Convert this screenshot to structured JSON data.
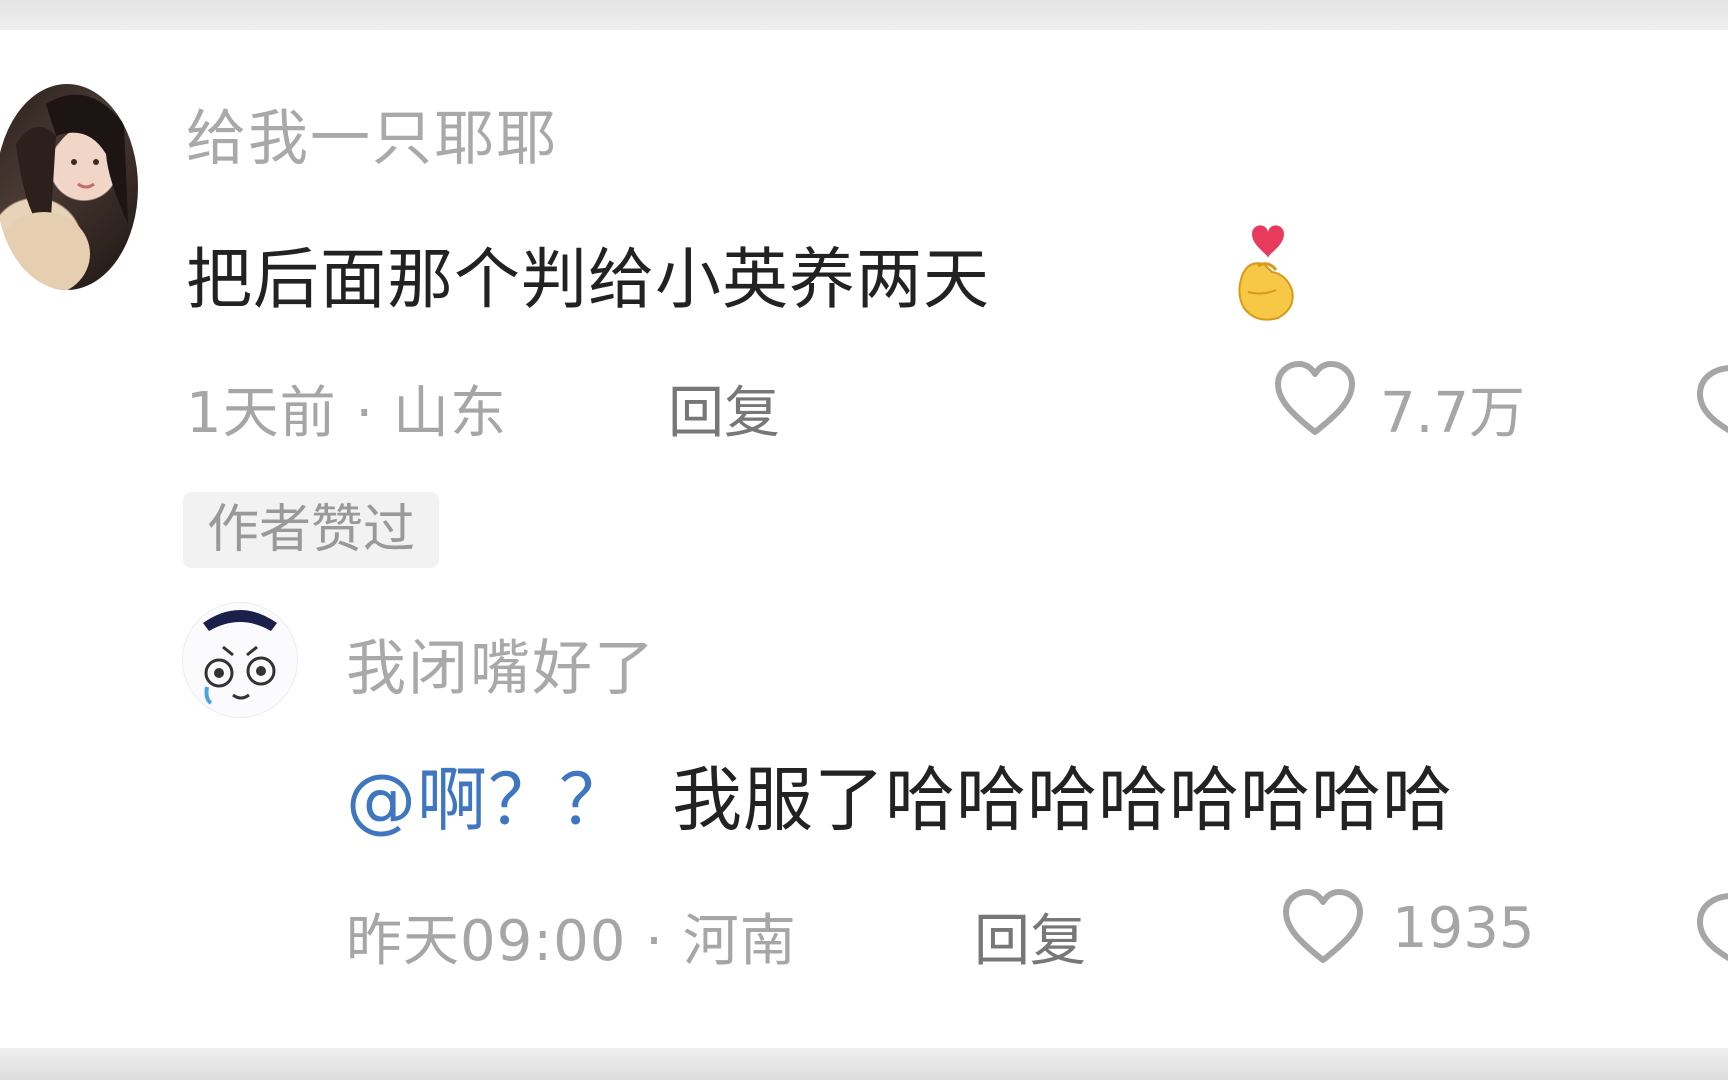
{
  "comment": {
    "username": "给我一只耶耶",
    "text": "把后面那个判给小英养两天",
    "emoji": "🫰",
    "time_location": "1天前 · 山东",
    "reply_label": "回复",
    "likes": "7.7万",
    "badge": "作者赞过",
    "like_color": "#a6a6a6",
    "avatar_icon": "avatar-photo-icon"
  },
  "reply": {
    "username": "我闭嘴好了",
    "mention": "@啊？？",
    "text": "我服了哈哈哈哈哈哈哈哈",
    "time_location": "昨天09:00 · 河南",
    "reply_label": "回复",
    "likes": "1935",
    "mention_color": "#3f76c0",
    "avatar_icon": "cartoon-face-avatar-icon"
  }
}
